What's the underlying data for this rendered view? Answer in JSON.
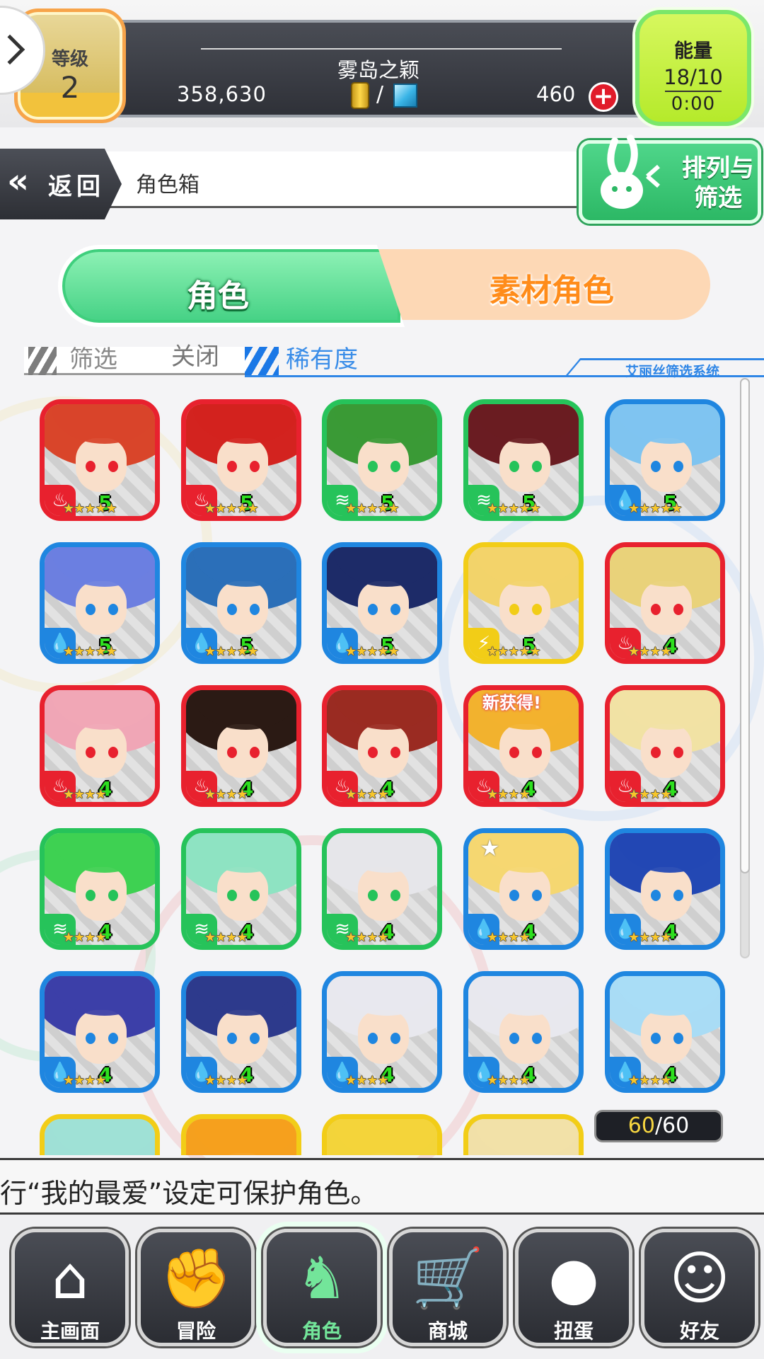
{
  "colors": {
    "fire": "#e8212e",
    "water": "#1f86e0",
    "wind": "#26c35a",
    "thunder": "#f2cd17",
    "accent_green": "#44d184",
    "accent_orange": "#ff8c1a"
  },
  "header": {
    "level_label": "等级",
    "level_value": "2",
    "player_name": "雾岛之颖",
    "gold": "358,630",
    "gems": "460",
    "currency_separator": "/",
    "energy_label": "能量",
    "energy_value": "18/10",
    "energy_timer": "0:00"
  },
  "nav_bar": {
    "back_label": "返回",
    "page_title": "角色箱",
    "sort_filter_label": "排列与筛选"
  },
  "tabs": {
    "characters": "角色",
    "materials": "素材角色"
  },
  "filter": {
    "filter_label": "筛选",
    "filter_state": "关闭",
    "rarity_label": "稀有度",
    "system_label": "艾丽丝筛选系统"
  },
  "grid": {
    "cards": [
      {
        "attribute": "fire",
        "rarity": "5",
        "stars": "★★★★★",
        "hair": "#d9452a"
      },
      {
        "attribute": "fire",
        "rarity": "5",
        "stars": "★★★★★",
        "hair": "#d3231f"
      },
      {
        "attribute": "wind",
        "rarity": "5",
        "stars": "★★★★★",
        "hair": "#3a9a36"
      },
      {
        "attribute": "wind",
        "rarity": "5",
        "stars": "★★★★★",
        "hair": "#6a1c22"
      },
      {
        "attribute": "water",
        "rarity": "5",
        "stars": "★★★★★",
        "hair": "#7fc4f0"
      },
      {
        "attribute": "water",
        "rarity": "5",
        "stars": "★★★★★",
        "hair": "#6c7fe0"
      },
      {
        "attribute": "water",
        "rarity": "5",
        "stars": "★★★★★",
        "hair": "#2b6fb8"
      },
      {
        "attribute": "water",
        "rarity": "5",
        "stars": "★★★★★",
        "hair": "#1d2b68"
      },
      {
        "attribute": "thunder",
        "rarity": "5",
        "stars": "★★★★★",
        "hair": "#f2d36a"
      },
      {
        "attribute": "fire",
        "rarity": "4",
        "stars": "★★★★",
        "hair": "#e9d27a"
      },
      {
        "attribute": "fire",
        "rarity": "4",
        "stars": "★★★★",
        "hair": "#f0a6b6"
      },
      {
        "attribute": "fire",
        "rarity": "4",
        "stars": "★★★★",
        "hair": "#2b1a14"
      },
      {
        "attribute": "fire",
        "rarity": "4",
        "stars": "★★★★",
        "hair": "#9a2b22"
      },
      {
        "attribute": "fire",
        "rarity": "4",
        "stars": "★★★★",
        "hair": "#f2b22e",
        "new_tag": "新获得!"
      },
      {
        "attribute": "fire",
        "rarity": "4",
        "stars": "★★★★",
        "hair": "#f1e2a4"
      },
      {
        "attribute": "wind",
        "rarity": "4",
        "stars": "★★★★",
        "hair": "#3ed152"
      },
      {
        "attribute": "wind",
        "rarity": "4",
        "stars": "★★★★",
        "hair": "#8ee3c2"
      },
      {
        "attribute": "wind",
        "rarity": "4",
        "stars": "★★★★",
        "hair": "#e6e6ea"
      },
      {
        "attribute": "water",
        "rarity": "4",
        "stars": "★★★★",
        "hair": "#f5d771",
        "favorite": true
      },
      {
        "attribute": "water",
        "rarity": "4",
        "stars": "★★★★",
        "hair": "#2348b4"
      },
      {
        "attribute": "water",
        "rarity": "4",
        "stars": "★★★★",
        "hair": "#3c3fa8"
      },
      {
        "attribute": "water",
        "rarity": "4",
        "stars": "★★★★",
        "hair": "#2d3a8c"
      },
      {
        "attribute": "water",
        "rarity": "4",
        "stars": "★★★★",
        "hair": "#e8e8ee"
      },
      {
        "attribute": "water",
        "rarity": "4",
        "stars": "★★★★",
        "hair": "#e8e8ee"
      },
      {
        "attribute": "water",
        "rarity": "4",
        "stars": "★★★★",
        "hair": "#a9dcf5"
      },
      {
        "attribute": "thunder",
        "rarity": "",
        "stars": "",
        "hair": "#9fe0d6"
      },
      {
        "attribute": "thunder",
        "rarity": "",
        "stars": "",
        "hair": "#f5a01e"
      },
      {
        "attribute": "thunder",
        "rarity": "",
        "stars": "",
        "hair": "#f3d43a"
      },
      {
        "attribute": "thunder",
        "rarity": "",
        "stars": "",
        "hair": "#f1e0a8"
      }
    ],
    "capacity_current": "60",
    "capacity_total": "60"
  },
  "hint": {
    "text": "行“我的最爱”设定可保护角色。"
  },
  "bottom_nav": [
    {
      "label": "主画面",
      "icon": "home-icon",
      "active": false
    },
    {
      "label": "冒险",
      "icon": "handshake-icon",
      "active": false
    },
    {
      "label": "角色",
      "icon": "bunny-icon",
      "active": true
    },
    {
      "label": "商城",
      "icon": "cart-icon",
      "active": false
    },
    {
      "label": "扭蛋",
      "icon": "egg-icon",
      "active": false
    },
    {
      "label": "好友",
      "icon": "friends-icon",
      "active": false
    }
  ]
}
